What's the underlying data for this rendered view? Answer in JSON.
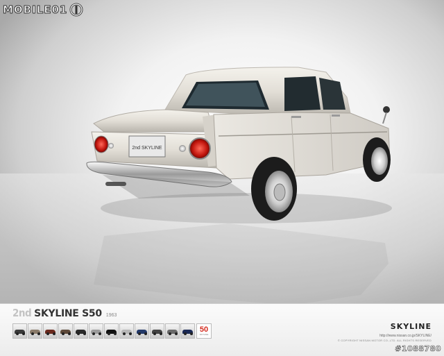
{
  "branding": {
    "watermark_logo": "MOBILE01",
    "logo_icon": "mobile01-ring-icon"
  },
  "car": {
    "plate_text": "2nd SKYLINE",
    "subject": "car-rear-three-quarter"
  },
  "footer": {
    "generation": "2nd",
    "model": "SKYLINE S50",
    "year": "1963",
    "brand": "SKYLINE",
    "url": "http://www.nissan.co.jp/SKYLINE/",
    "copyright": "© COPYRIGHT NISSAN MOTOR CO.,LTD. ALL RIGHTS RESERVED",
    "badge_number": "50",
    "badge_text": "SKYLINE",
    "thumbnails": [
      {
        "tone": "#3a3a3a"
      },
      {
        "tone": "#8a7b6a"
      },
      {
        "tone": "#6b2a1e"
      },
      {
        "tone": "#5e4a3a"
      },
      {
        "tone": "#2a2a2a"
      },
      {
        "tone": "#9c9c9c"
      },
      {
        "tone": "#111111"
      },
      {
        "tone": "#b7b7b7"
      },
      {
        "tone": "#243a6a"
      },
      {
        "tone": "#444444"
      },
      {
        "tone": "#6a6a6a"
      },
      {
        "tone": "#1b2a55"
      }
    ]
  },
  "image_id_watermark": "#1088780"
}
